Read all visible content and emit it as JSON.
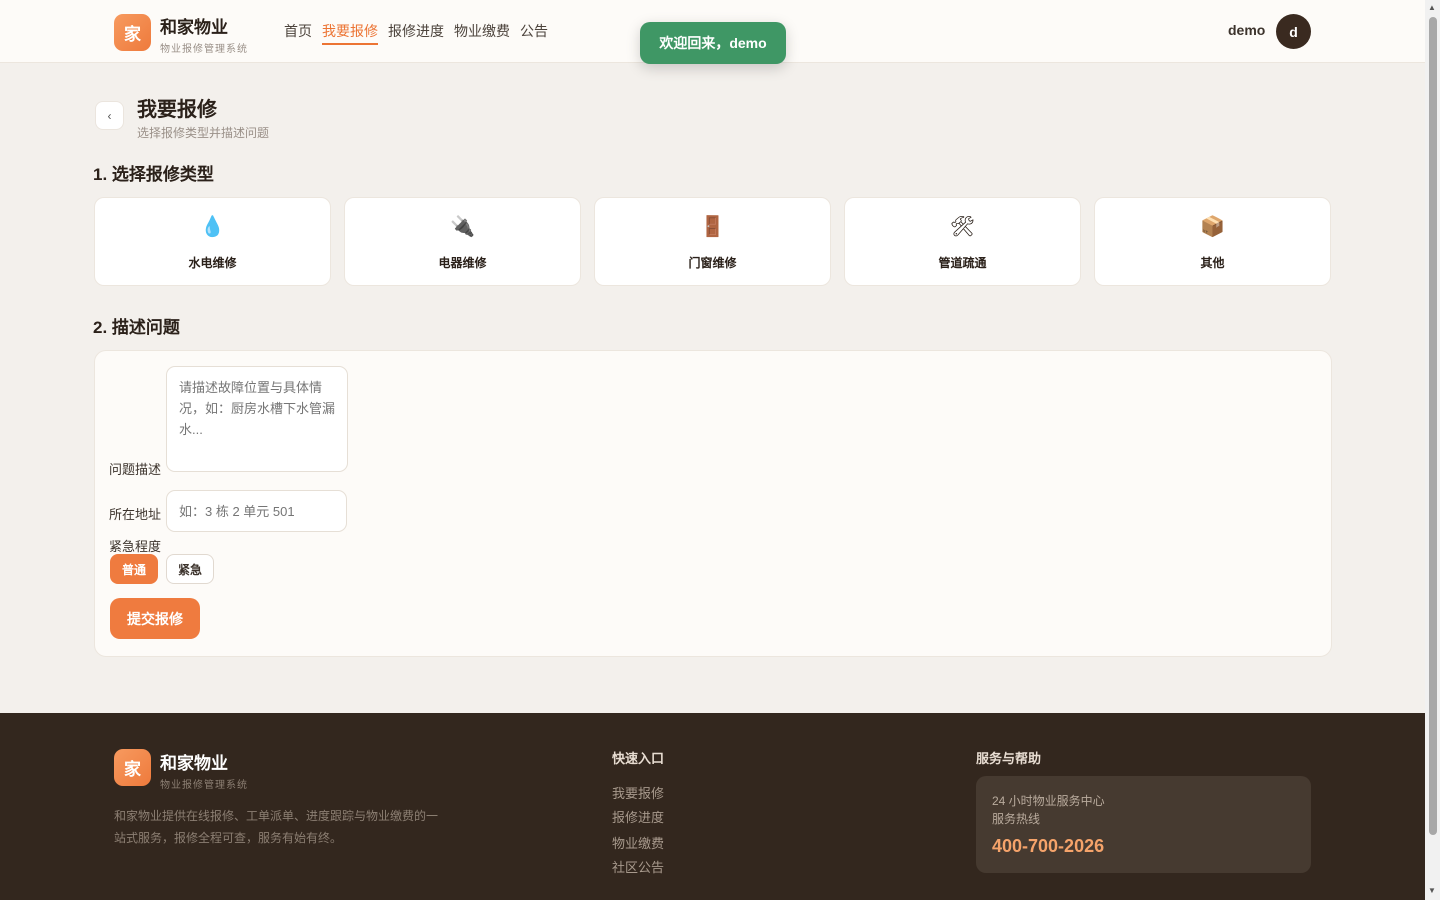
{
  "header": {
    "logo_char": "家",
    "brand": "和家物业",
    "brand_sub": "物业报修管理系统",
    "nav": [
      "首页",
      "我要报修",
      "报修进度",
      "物业缴费",
      "公告"
    ],
    "active_nav": "我要报修",
    "toast": "欢迎回来，demo",
    "user_name": "demo",
    "avatar_char": "d"
  },
  "page": {
    "back_icon": "‹",
    "title": "我要报修",
    "subtitle": "选择报修类型并描述问题"
  },
  "section1": {
    "title": "1. 选择报修类型",
    "types": [
      {
        "icon": "💧",
        "label": "水电维修"
      },
      {
        "icon": "🔌",
        "label": "电器维修"
      },
      {
        "icon": "🚪",
        "label": "门窗维修"
      },
      {
        "icon": "🛠",
        "label": "管道疏通"
      },
      {
        "icon": "📦",
        "label": "其他"
      }
    ]
  },
  "section2": {
    "title": "2. 描述问题",
    "desc_label": "问题描述",
    "desc_placeholder": "请描述故障位置与具体情况，如：厨房水槽下水管漏水...",
    "addr_label": "所在地址",
    "addr_placeholder": "如：3 栋 2 单元 501",
    "urgency_label": "紧急程度",
    "urgency_options": [
      "普通",
      "紧急"
    ],
    "urgency_selected": "普通",
    "submit": "提交报修"
  },
  "footer": {
    "logo_char": "家",
    "brand": "和家物业",
    "brand_sub": "物业报修管理系统",
    "desc": "和家物业提供在线报修、工单派单、进度跟踪与物业缴费的一站式服务，报修全程可查，服务有始有终。",
    "quick_title": "快速入口",
    "quick_links": [
      "我要报修",
      "报修进度",
      "物业缴费",
      "社区公告"
    ],
    "help_title": "服务与帮助",
    "help_line1": "24 小时物业服务中心",
    "help_line2": "服务热线",
    "hotline": "400-700-2026"
  },
  "colors": {
    "accent": "#ef7b3f",
    "toast_green": "#3f9765",
    "footer_bg": "#33271e"
  }
}
